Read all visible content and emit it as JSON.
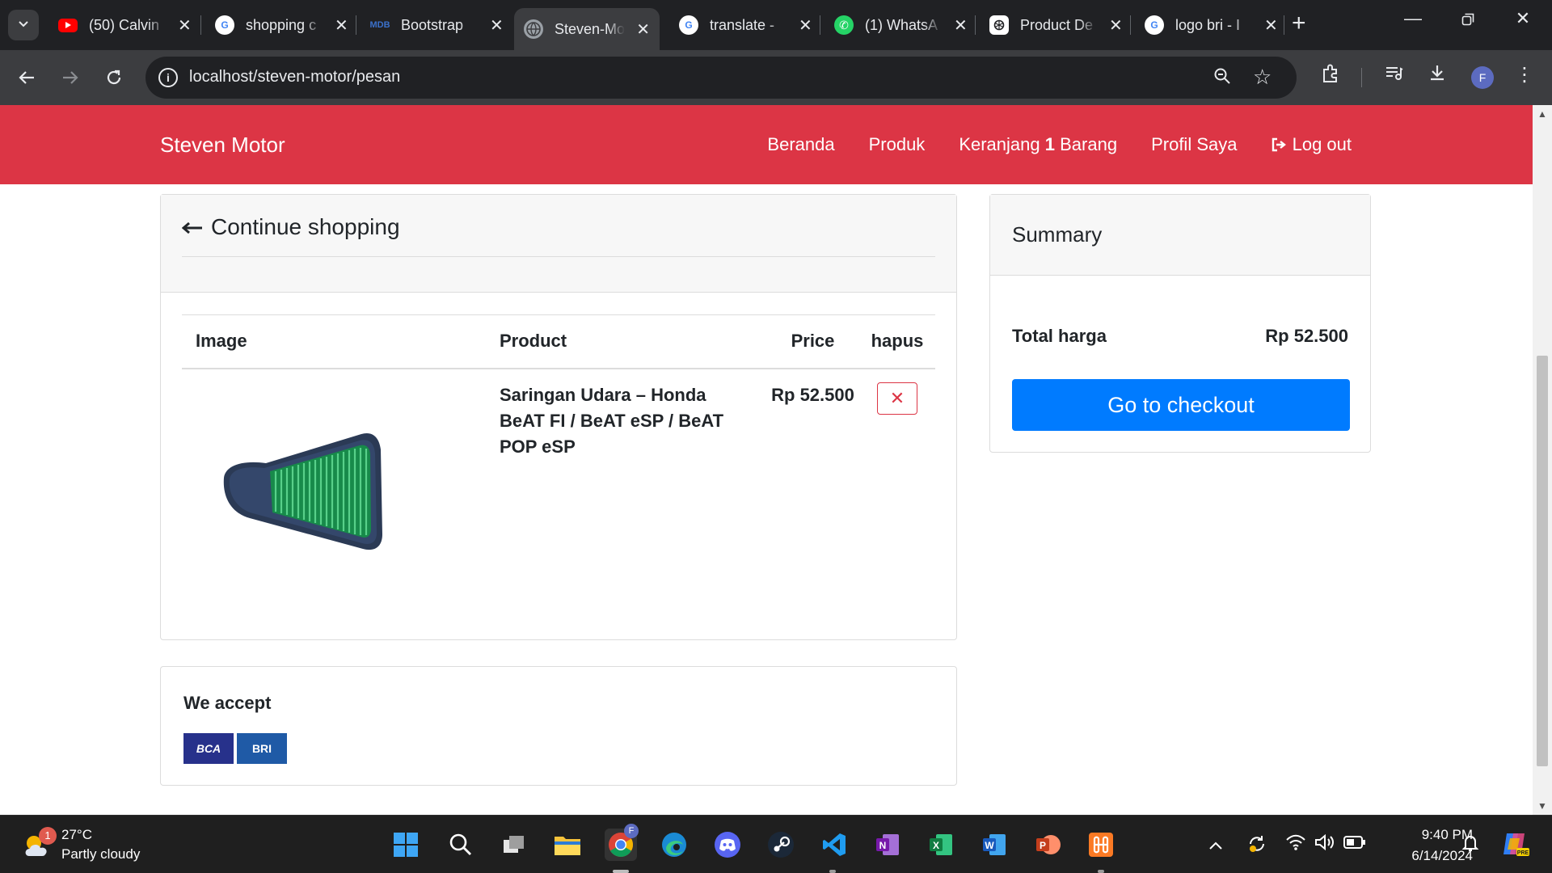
{
  "browser": {
    "tabs": [
      {
        "title": "(50) Calvin",
        "favicon": "youtube-icon",
        "color": "#ff0000"
      },
      {
        "title": "shopping c",
        "favicon": "google-icon",
        "color": "#ffffff"
      },
      {
        "title": "Bootstrap",
        "favicon": "mdb-icon",
        "color": "#3b71ca"
      },
      {
        "title": "Steven-Mo",
        "favicon": "globe-icon",
        "color": "#9aa0a6"
      },
      {
        "title": "translate -",
        "favicon": "google-icon",
        "color": "#ffffff"
      },
      {
        "title": "(1) WhatsA",
        "favicon": "whatsapp-icon",
        "color": "#25d366"
      },
      {
        "title": "Product De",
        "favicon": "chatgpt-icon",
        "color": "#ffffff"
      },
      {
        "title": "logo bri - I",
        "favicon": "google-icon",
        "color": "#ffffff"
      }
    ],
    "active_tab_index": 3,
    "url": "localhost/steven-motor/pesan",
    "profile_initial": "F"
  },
  "navbar": {
    "brand": "Steven Motor",
    "links": {
      "beranda": "Beranda",
      "produk": "Produk",
      "keranjang_prefix": "Keranjang",
      "keranjang_count": "1",
      "keranjang_suffix": "Barang",
      "profil": "Profil Saya",
      "logout": "Log out"
    },
    "color": "#dc3545"
  },
  "cart": {
    "continue_label": "Continue shopping",
    "columns": {
      "image": "Image",
      "product": "Product",
      "price": "Price",
      "hapus": "hapus"
    },
    "items": [
      {
        "product": "Saringan Udara – Honda BeAT FI / BeAT eSP / BeAT POP eSP",
        "price": "Rp 52.500",
        "image_icon": "air-filter-image"
      }
    ]
  },
  "payment": {
    "title": "We accept",
    "methods": [
      {
        "label": "BCA",
        "color": "#1e3a8a"
      },
      {
        "label": "BRI",
        "color": "#1f5aa6"
      }
    ]
  },
  "summary": {
    "title": "Summary",
    "total_label": "Total harga",
    "total_value": "Rp 52.500",
    "checkout_label": "Go to checkout",
    "checkout_color": "#007bff"
  },
  "taskbar": {
    "weather_temp": "27°C",
    "weather_desc": "Partly cloudy",
    "weather_badge": "1",
    "time": "9:40 PM",
    "date": "6/14/2024"
  }
}
